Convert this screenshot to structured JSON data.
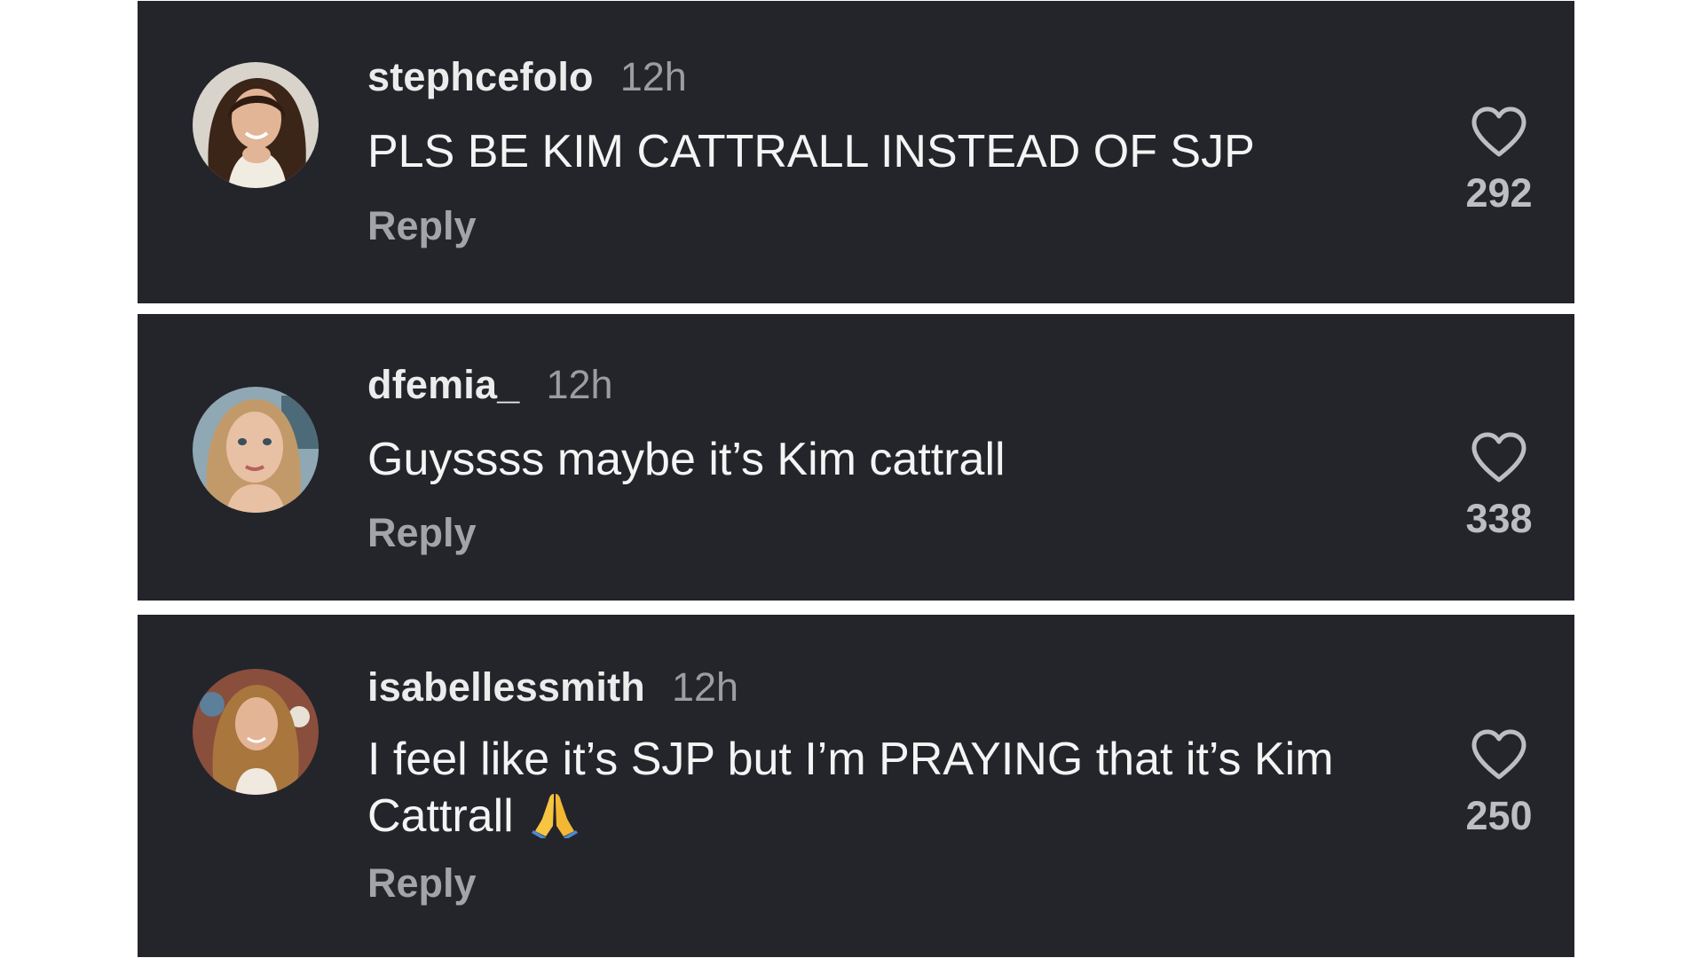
{
  "comments": [
    {
      "username": "stephcefolo",
      "time": "12h",
      "text": "PLS BE KIM CATTRALL INSTEAD OF SJP",
      "text_suffix": "",
      "reply_label": "Reply",
      "likes": "292",
      "avatar_icon": "avatar-photo-woman-dark-hair"
    },
    {
      "username": "dfemia_",
      "time": "12h",
      "text": "Guyssss maybe it’s Kim cattrall",
      "text_suffix": "",
      "reply_label": "Reply",
      "likes": "338",
      "avatar_icon": "avatar-photo-woman-blonde-hair"
    },
    {
      "username": "isabellessmith",
      "time": "12h",
      "text": "I feel like it’s SJP but I’m PRAYING that it’s Kim Cattrall",
      "text_suffix": "🙏",
      "reply_label": "Reply",
      "likes": "250",
      "avatar_icon": "avatar-photo-woman-long-hair"
    }
  ],
  "icons": {
    "like": "heart-outline-icon",
    "emoji": "folded-hands-emoji"
  },
  "colors": {
    "card_background": "#23252b",
    "page_background": "#ffffff",
    "username": "#ececec",
    "secondary_text": "#9c9da1"
  }
}
